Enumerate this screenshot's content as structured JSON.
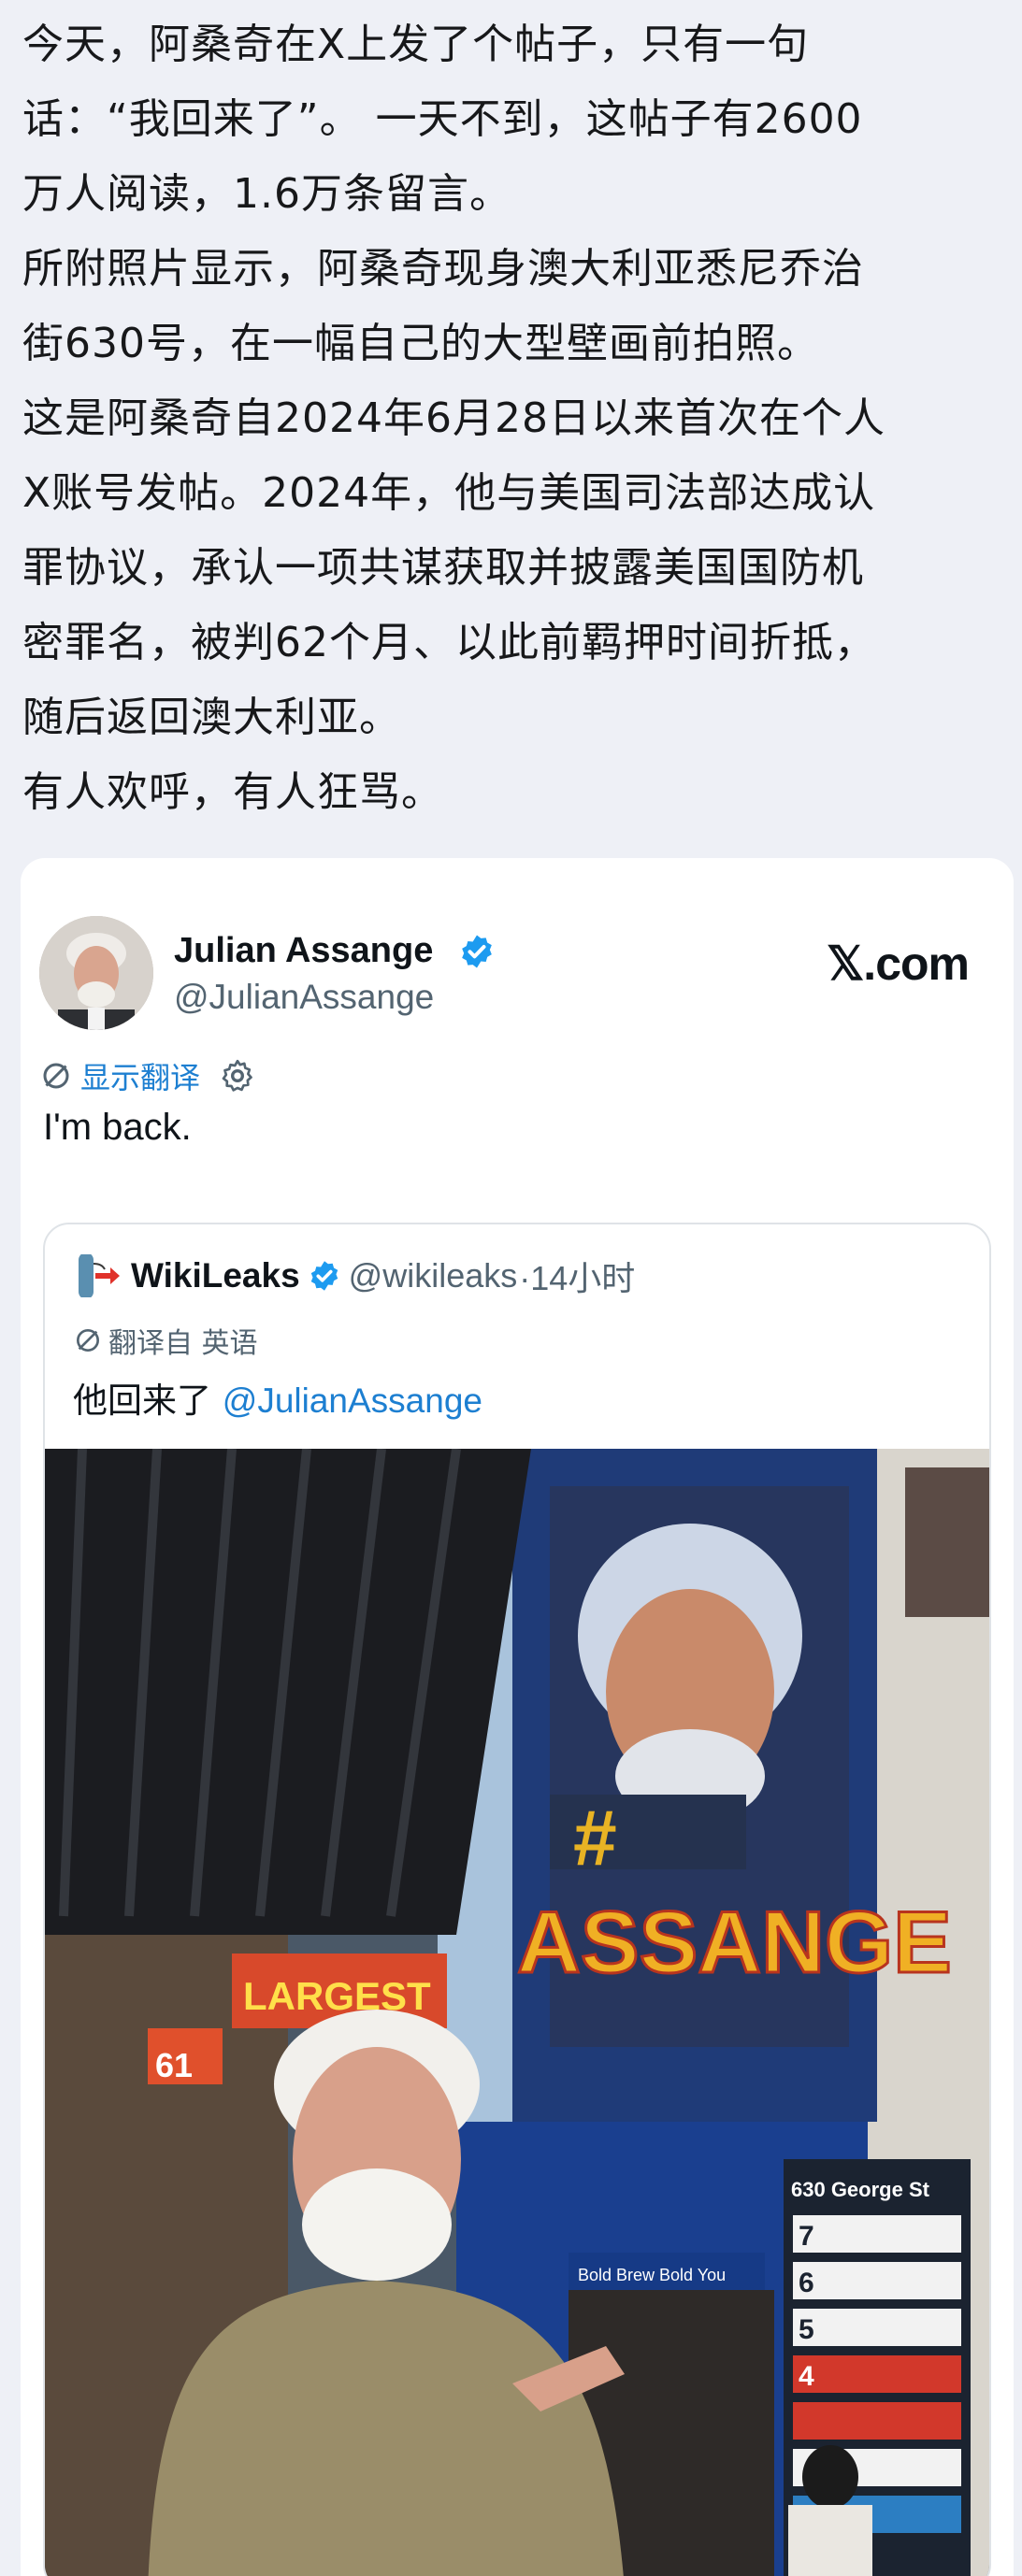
{
  "post": {
    "lines": [
      "今天，阿桑奇在X上发了个帖子，只有一句",
      "话：“我回来了”。 一天不到，这帖子有2600",
      "万人阅读，1.6万条留言。",
      "所附照片显示，阿桑奇现身澳大利亚悉尼乔治",
      "街630号，在一幅自己的大型壁画前拍照。",
      "这是阿桑奇自2024年6月28日以来首次在个人",
      "X账号发帖。2024年，他与美国司法部达成认",
      "罪协议，承认一项共谋获取并披露美国国防机",
      "密罪名，被判62个月、以此前羁押时间折抵，",
      "随后返回澳大利亚。",
      "有人欢呼，有人狂骂。"
    ]
  },
  "tweet": {
    "author_name": "Julian Assange",
    "author_handle": "@JulianAssange",
    "site": "𝕏.com",
    "show_translation": "显示翻译",
    "text": "I'm back.",
    "verified_color": "#1d9bf0",
    "link_color": "#1d7fd1"
  },
  "quote": {
    "name": "WikiLeaks",
    "handle": "@wikileaks",
    "time": "·14小时",
    "translated_from": "翻译自 英语",
    "text": "他回来了",
    "mention": "@JulianAssange"
  },
  "photo": {
    "mural_text": "ASSANGE",
    "mural_hash": "#",
    "sign_largest": "LARGEST",
    "street_sign": "630 George St",
    "directory_numbers": [
      "7",
      "6",
      "5",
      "4"
    ],
    "shop_sign": "Bold Brew Bold You",
    "sign_61": "61"
  },
  "icons": [
    "verified-badge-icon",
    "translate-icon",
    "gear-icon",
    "wikileaks-logo-icon"
  ]
}
